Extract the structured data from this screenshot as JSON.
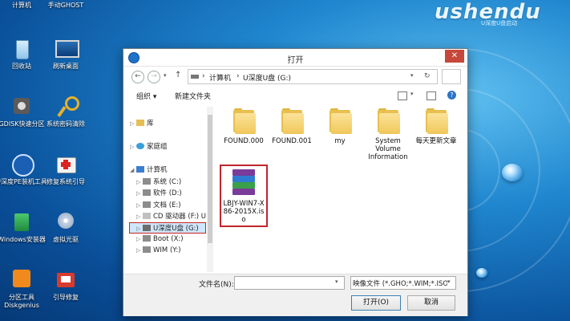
{
  "brand": {
    "logo": "ushendu",
    "sub": "U深度U盘启动"
  },
  "desktop_icons": [
    {
      "label": "计算机",
      "icon": "computer-icon"
    },
    {
      "label": "手动GHOST",
      "icon": "ghost-icon"
    },
    {
      "label": "回收站",
      "icon": "recycle-bin-icon"
    },
    {
      "label": "刷新桌面",
      "icon": "refresh-desktop-icon"
    },
    {
      "label": "GDISK快速分区",
      "icon": "gdisk-icon"
    },
    {
      "label": "系统密码清除",
      "icon": "key-icon"
    },
    {
      "label": "U深度PE装机工具",
      "icon": "pe-install-icon"
    },
    {
      "label": "修复系统引导",
      "icon": "repair-boot-icon"
    },
    {
      "label": "Windows安装器",
      "icon": "windows-installer-icon"
    },
    {
      "label": "虚拟光驱",
      "icon": "virtual-drive-icon"
    },
    {
      "label": "分区工具Diskgenius",
      "icon": "diskgenius-icon"
    },
    {
      "label": "引导修复",
      "icon": "boot-repair-icon"
    }
  ],
  "dialog": {
    "title": "打开",
    "address": {
      "seg1": "计算机",
      "sep": "›",
      "seg2": "U深度U盘 (G:)"
    },
    "toolbar": {
      "organize": "组织 ▾",
      "new_folder": "新建文件夹"
    },
    "sidebar": {
      "items": [
        {
          "label": "库",
          "arrow": "▷",
          "indent": 0
        },
        {
          "label": "家庭组",
          "arrow": "▷",
          "indent": 0
        },
        {
          "label": "计算机",
          "arrow": "◢",
          "indent": 0
        },
        {
          "label": "系统 (C:)",
          "arrow": "▷",
          "indent": 1
        },
        {
          "label": "软件 (D:)",
          "arrow": "▷",
          "indent": 1
        },
        {
          "label": "文档 (E:)",
          "arrow": "▷",
          "indent": 1
        },
        {
          "label": "CD 驱动器 (F:) U",
          "arrow": "▷",
          "indent": 1
        },
        {
          "label": "U深度U盘 (G:)",
          "arrow": "▷",
          "indent": 1,
          "selected": true
        },
        {
          "label": "Boot (X:)",
          "arrow": "▷",
          "indent": 1
        },
        {
          "label": "WIM (Y:)",
          "arrow": "▷",
          "indent": 1
        }
      ]
    },
    "files": [
      {
        "name": "FOUND.000",
        "type": "folder"
      },
      {
        "name": "FOUND.001",
        "type": "folder"
      },
      {
        "name": "my",
        "type": "folder"
      },
      {
        "name": "System Volume Information",
        "type": "folder"
      },
      {
        "name": "每天更新文章",
        "type": "folder"
      },
      {
        "name": "LBJY-WIN7-X86-2015X.iso",
        "type": "iso"
      }
    ],
    "bottom": {
      "filename_label": "文件名(N):",
      "filename_value": "",
      "filetype_value": "映像文件 (*.GHO;*.WIM;*.ISO",
      "open_label": "打开(O)",
      "cancel_label": "取消"
    }
  }
}
